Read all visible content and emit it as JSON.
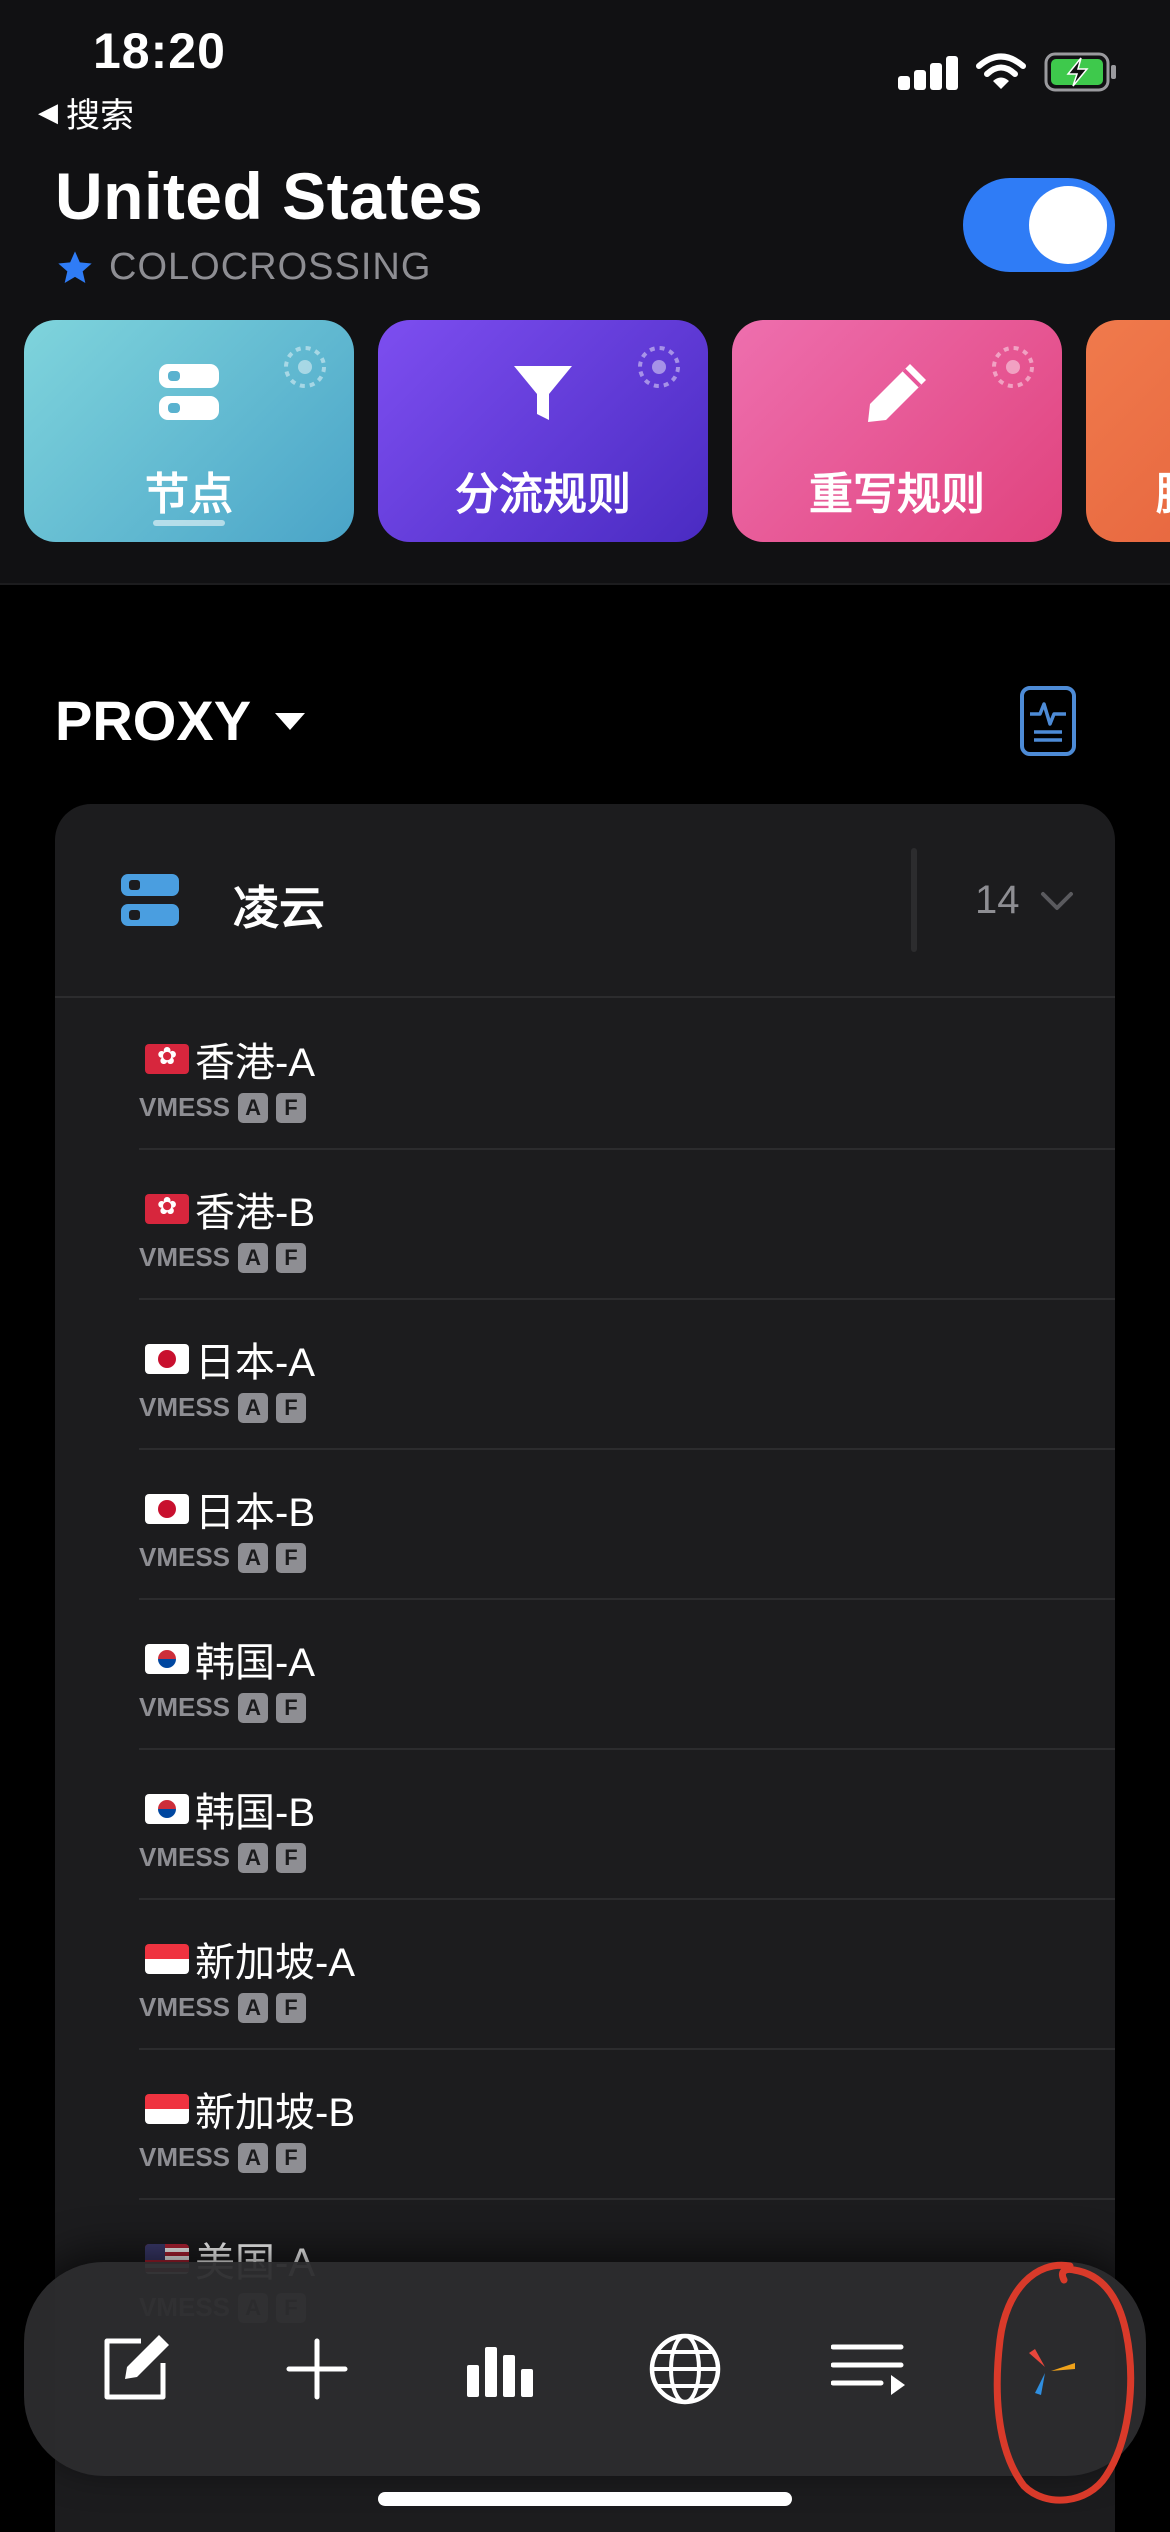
{
  "status_bar": {
    "time": "18:20",
    "back_label": "搜索",
    "icons": [
      "cellular-signal-icon",
      "wifi-icon",
      "battery-charging-icon"
    ]
  },
  "header": {
    "title": "United States",
    "subtitle": "COLOCROSSING",
    "subtitle_icon": "star-icon",
    "toggle_on": true,
    "accent_color": "#2f7cf6"
  },
  "feature_cards": [
    {
      "label": "节点",
      "icon": "server-icon",
      "selected": true
    },
    {
      "label": "分流规则",
      "icon": "filter-icon",
      "selected": false
    },
    {
      "label": "重写规则",
      "icon": "pencil-icon",
      "selected": false
    },
    {
      "label": "脚",
      "icon": "script-icon",
      "selected": false
    }
  ],
  "proxy_section": {
    "title": "PROXY",
    "title_icon": "dropdown-caret-icon",
    "action_icon": "activity-report-icon"
  },
  "group": {
    "name": "凌云",
    "icon": "server-icon",
    "count": "14",
    "expand_icon": "chevron-down-icon"
  },
  "nodes": [
    {
      "flag": "hk",
      "name": "香港-A",
      "protocol": "VMESS",
      "tags": [
        "A",
        "F"
      ]
    },
    {
      "flag": "hk",
      "name": "香港-B",
      "protocol": "VMESS",
      "tags": [
        "A",
        "F"
      ]
    },
    {
      "flag": "jp",
      "name": "日本-A",
      "protocol": "VMESS",
      "tags": [
        "A",
        "F"
      ]
    },
    {
      "flag": "jp",
      "name": "日本-B",
      "protocol": "VMESS",
      "tags": [
        "A",
        "F"
      ]
    },
    {
      "flag": "kr",
      "name": "韩国-A",
      "protocol": "VMESS",
      "tags": [
        "A",
        "F"
      ]
    },
    {
      "flag": "kr",
      "name": "韩国-B",
      "protocol": "VMESS",
      "tags": [
        "A",
        "F"
      ]
    },
    {
      "flag": "sg",
      "name": "新加坡-A",
      "protocol": "VMESS",
      "tags": [
        "A",
        "F"
      ]
    },
    {
      "flag": "sg",
      "name": "新加坡-B",
      "protocol": "VMESS",
      "tags": [
        "A",
        "F"
      ]
    },
    {
      "flag": "us",
      "name": "美国-A",
      "protocol": "VMESS",
      "tags": [
        "A",
        "F"
      ]
    }
  ],
  "toolbar": {
    "items": [
      "edit-icon",
      "add-icon",
      "stats-icon",
      "globe-icon",
      "playlist-icon",
      "app-logo-icon"
    ]
  }
}
